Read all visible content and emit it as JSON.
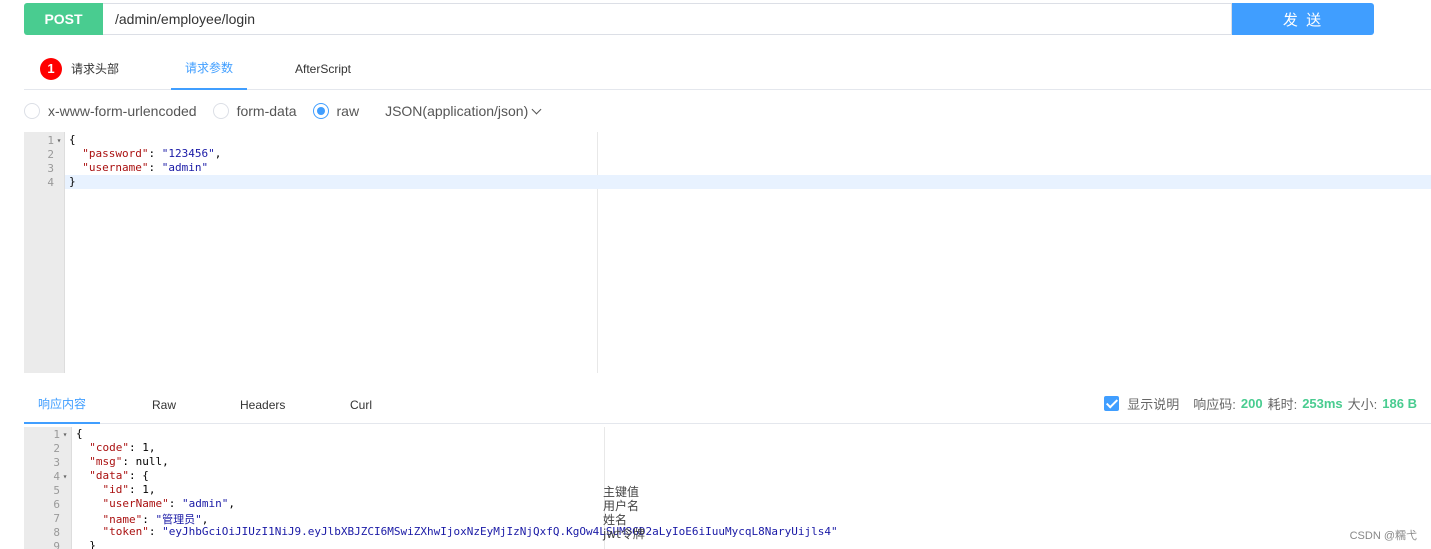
{
  "request": {
    "method": "POST",
    "url": "/admin/employee/login",
    "send_label": "发 送"
  },
  "request_tabs": [
    {
      "label": "请求头部",
      "badge": "1"
    },
    {
      "label": "请求参数"
    },
    {
      "label": "AfterScript"
    }
  ],
  "body_types": {
    "options": [
      "x-www-form-urlencoded",
      "form-data",
      "raw"
    ],
    "selected": "raw",
    "content_type": "JSON(application/json)"
  },
  "request_body": {
    "line_numbers": [
      "1",
      "2",
      "3",
      "4"
    ],
    "lines": [
      [
        "{",
        ""
      ],
      [
        "  \"password\"",
        ": ",
        "\"123456\"",
        ","
      ],
      [
        "  \"username\"",
        ": ",
        "\"admin\"",
        ""
      ],
      [
        "}",
        ""
      ]
    ]
  },
  "response_tabs": [
    "响应内容",
    "Raw",
    "Headers",
    "Curl"
  ],
  "response_info": {
    "show_desc_label": "显示说明",
    "status_label": "响应码:",
    "status_value": "200",
    "time_label": "耗时:",
    "time_value": "253ms",
    "size_label": "大小:",
    "size_value": "186 B"
  },
  "response_body": {
    "line_numbers": [
      "1",
      "2",
      "3",
      "4",
      "5",
      "6",
      "7",
      "8",
      "9"
    ],
    "l1": "{",
    "l2k": "\"code\"",
    "l2v": "1",
    "l3k": "\"msg\"",
    "l3v": "null",
    "l4k": "\"data\"",
    "l4v": "{",
    "l5k": "\"id\"",
    "l5v": "1",
    "l6k": "\"userName\"",
    "l6v": "\"admin\"",
    "l7k": "\"name\"",
    "l7v": "\"管理员\"",
    "l8k": "\"token\"",
    "l8v": "\"eyJhbGciOiJIUzI1NiJ9.eyJlbXBJZCI6MSwiZXhwIjoxNzEyMjIzNjQxfQ.KgOw4LSUM3GD2aLyIoE6iIuuMycqL8NaryUijls4\"",
    "l9": "}",
    "descriptions": [
      "主键值",
      "用户名",
      "姓名",
      "jwt令牌"
    ]
  },
  "watermark": "CSDN @糯弋"
}
